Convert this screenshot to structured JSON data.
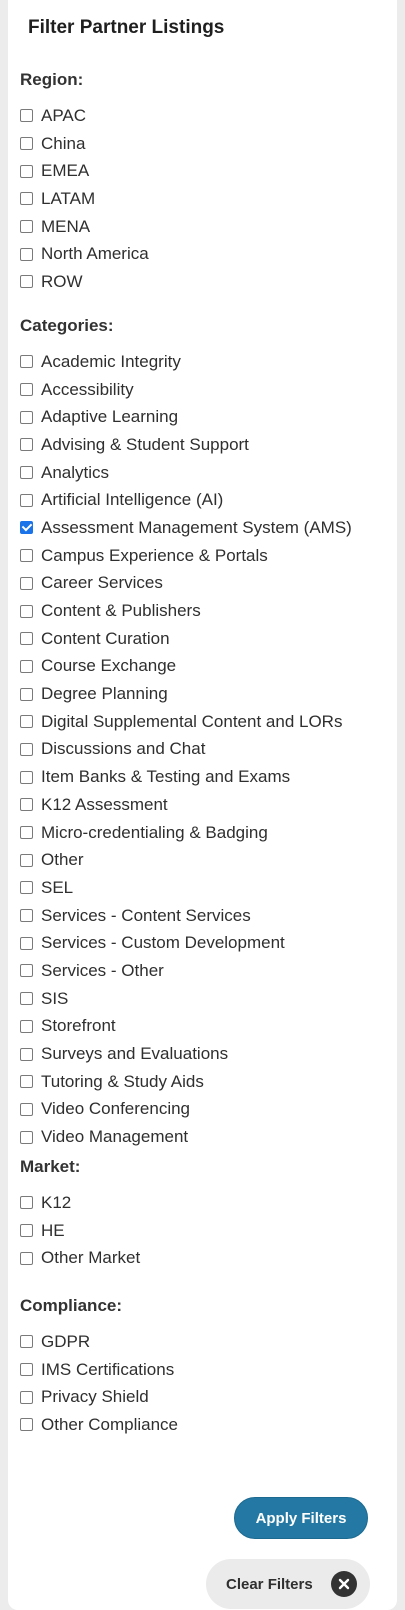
{
  "panel": {
    "title": "Filter Partner Listings"
  },
  "region": {
    "heading": "Region:",
    "options": [
      {
        "label": "APAC",
        "checked": false
      },
      {
        "label": "China",
        "checked": false
      },
      {
        "label": "EMEA",
        "checked": false
      },
      {
        "label": "LATAM",
        "checked": false
      },
      {
        "label": "MENA",
        "checked": false
      },
      {
        "label": "North America",
        "checked": false
      },
      {
        "label": "ROW",
        "checked": false
      }
    ]
  },
  "categories": {
    "heading": "Categories:",
    "options": [
      {
        "label": "Academic Integrity",
        "checked": false
      },
      {
        "label": "Accessibility",
        "checked": false
      },
      {
        "label": "Adaptive Learning",
        "checked": false
      },
      {
        "label": "Advising & Student Support",
        "checked": false
      },
      {
        "label": "Analytics",
        "checked": false
      },
      {
        "label": "Artificial Intelligence (AI)",
        "checked": false
      },
      {
        "label": "Assessment Management System (AMS)",
        "checked": true
      },
      {
        "label": "Campus Experience & Portals",
        "checked": false
      },
      {
        "label": "Career Services",
        "checked": false
      },
      {
        "label": "Content & Publishers",
        "checked": false
      },
      {
        "label": "Content Curation",
        "checked": false
      },
      {
        "label": "Course Exchange",
        "checked": false
      },
      {
        "label": "Degree Planning",
        "checked": false
      },
      {
        "label": "Digital Supplemental Content and LORs",
        "checked": false
      },
      {
        "label": "Discussions and Chat",
        "checked": false
      },
      {
        "label": "Item Banks & Testing and Exams",
        "checked": false
      },
      {
        "label": "K12 Assessment",
        "checked": false
      },
      {
        "label": "Micro-credentialing & Badging",
        "checked": false
      },
      {
        "label": "Other",
        "checked": false
      },
      {
        "label": "SEL",
        "checked": false
      },
      {
        "label": "Services - Content Services",
        "checked": false
      },
      {
        "label": "Services - Custom Development",
        "checked": false
      },
      {
        "label": "Services - Other",
        "checked": false
      },
      {
        "label": "SIS",
        "checked": false
      },
      {
        "label": "Storefront",
        "checked": false
      },
      {
        "label": "Surveys and Evaluations",
        "checked": false
      },
      {
        "label": "Tutoring & Study Aids",
        "checked": false
      },
      {
        "label": "Video Conferencing",
        "checked": false
      },
      {
        "label": "Video Management",
        "checked": false
      }
    ]
  },
  "market": {
    "heading": "Market:",
    "options": [
      {
        "label": "K12",
        "checked": false
      },
      {
        "label": "HE",
        "checked": false
      },
      {
        "label": "Other Market",
        "checked": false
      }
    ]
  },
  "compliance": {
    "heading": "Compliance:",
    "options": [
      {
        "label": "GDPR",
        "checked": false
      },
      {
        "label": "IMS Certifications",
        "checked": false
      },
      {
        "label": "Privacy Shield",
        "checked": false
      },
      {
        "label": "Other Compliance",
        "checked": false
      }
    ]
  },
  "actions": {
    "apply_label": "Apply Filters",
    "clear_label": "Clear Filters",
    "clear_icon": "close-icon"
  },
  "colors": {
    "checkbox_checked": "#1a73e8",
    "apply_button": "#2379a3",
    "clear_button": "#ebebeb",
    "clear_icon_bg": "#333333"
  }
}
